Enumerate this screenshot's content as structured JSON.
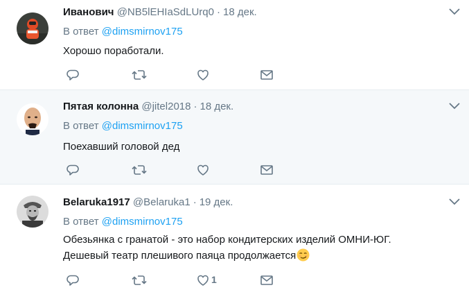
{
  "tweets": [
    {
      "fullname": "Иванович",
      "username": "@NB5lEHIaSdLUrq0",
      "separator": "·",
      "time": "18 дек.",
      "reply_prefix": "В ответ",
      "reply_mention": "@dimsmirnov175",
      "text_lines": [
        "Хорошо поработали."
      ],
      "likes": ""
    },
    {
      "fullname": "Пятая колонна",
      "username": "@jitel2018",
      "separator": "·",
      "time": "18 дек.",
      "reply_prefix": "В ответ",
      "reply_mention": "@dimsmirnov175",
      "text_lines": [
        "Поехавший головой дед"
      ],
      "likes": ""
    },
    {
      "fullname": "Belaruka1917",
      "username": "@Belaruka1",
      "separator": "·",
      "time": "19 дек.",
      "reply_prefix": "В ответ",
      "reply_mention": "@dimsmirnov175",
      "text_lines": [
        "Обезьянка с гранатой - это набор кондитерских изделий ОМНИ-ЮГ.",
        "Дешевый театр плешивого паяца продолжается"
      ],
      "likes": "1"
    }
  ],
  "icons": {
    "reply": "reply-icon",
    "retweet": "retweet-icon",
    "like": "heart-icon",
    "dm": "envelope-icon",
    "more": "chevron-down-icon",
    "emoji": "smirking-face-emoji"
  },
  "colors": {
    "link": "#1da1f2",
    "secondary_text": "#657786",
    "highlight_background": "#f5f8fa",
    "divider": "#e6ecf0"
  }
}
